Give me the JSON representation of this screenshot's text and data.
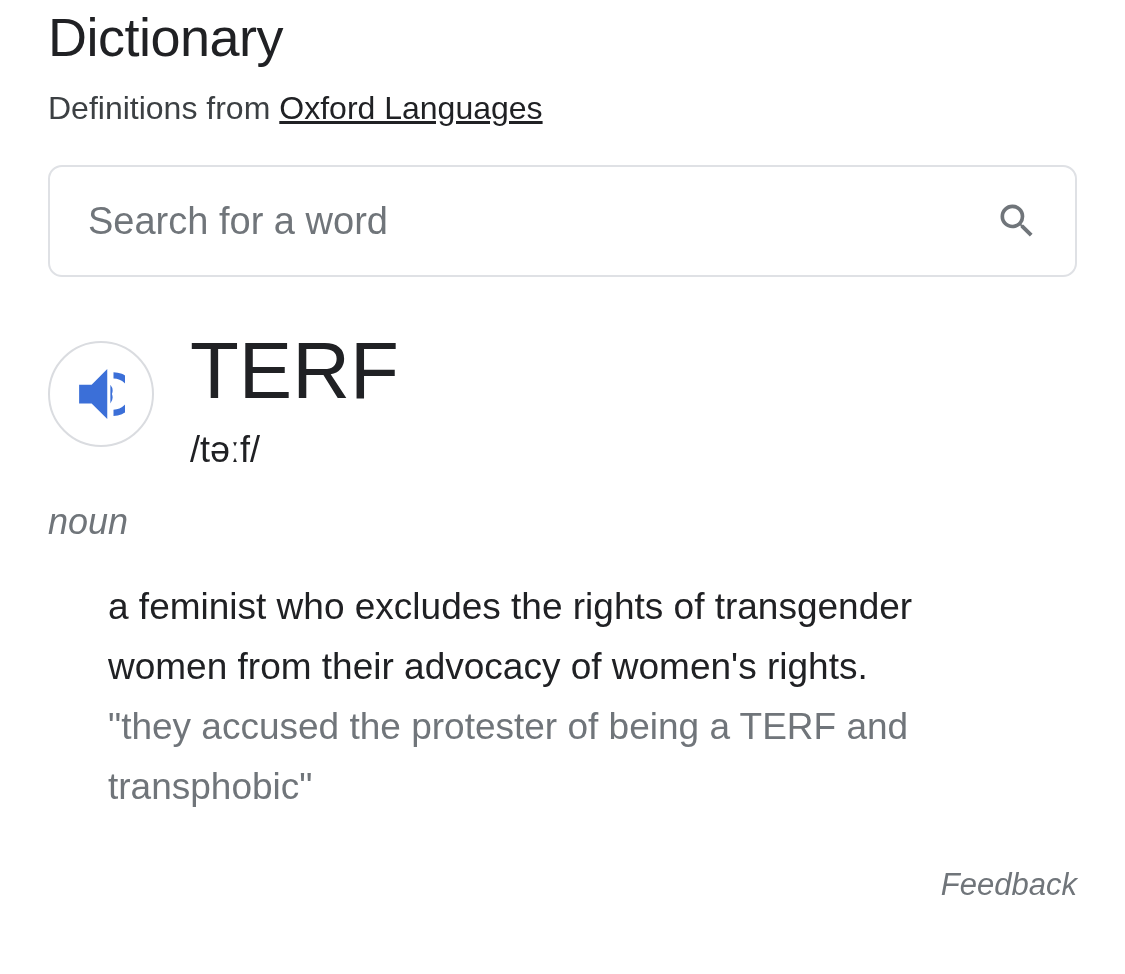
{
  "title": "Dictionary",
  "source": {
    "prefix": "Definitions from",
    "link": "Oxford Languages"
  },
  "search": {
    "placeholder": "Search for a word"
  },
  "entry": {
    "word": "TERF",
    "phonetic": "/təːf/",
    "part_of_speech": "noun",
    "definitions": [
      {
        "text": "a feminist who excludes the rights of transgender women from their advocacy of women's rights.",
        "example": "\"they accused the protester of being a TERF and transphobic\""
      }
    ]
  },
  "feedback": "Feedback"
}
